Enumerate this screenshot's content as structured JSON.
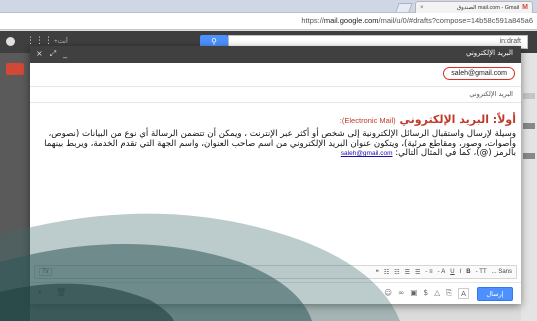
{
  "browser": {
    "tab_title": "mail.com - Gmail الصندوق",
    "tab_close": "×",
    "url_prefix": "https://",
    "url_host": "mail.google.com",
    "url_path": "/mail/u/0/#drafts?compose=14b58c591a845a6"
  },
  "gmail_bar": {
    "plus_label": "+أنت",
    "search_value": "in:draft"
  },
  "compose": {
    "window_title": "البريد الإلكتروني",
    "controls": [
      "×",
      "⤢",
      "_"
    ],
    "recipient": "saleh@gmail.com",
    "subject": "البريد الإلكتروني",
    "heading_ar": "أولاً: البريد الإلكتروني",
    "heading_en": "(Electronic Mail):",
    "body_text": "وسيلة لإرسال واستقبال الرسائل الإلكترونية إلى شخص أو أكثر عبر الإنترنت ، ويمكن أن تتضمن الرسالة أي نوع من البيانات (نصوص، وأصوات، وصور، ومقاطع مرئية)، ويتكون عنوان البريد الإلكتروني من اسم صاحب العنوان، واسم الجهة التي تقدم الخدمة، ويربط بينهما بالرمز (@)، كما في المثال التالي: ",
    "body_email": "saleh@gmail.com",
    "send_label": "إرسال",
    "format_toggle": "A"
  },
  "format_toolbar": {
    "items": [
      "Sans ...",
      "TT -",
      "A -",
      "B",
      "I",
      "U",
      "A -",
      "≡ -",
      "☰",
      "☰",
      "☷",
      "☷",
      "❝",
      "Tx"
    ]
  },
  "icons": {
    "apps": "grid-apps-icon",
    "search": "search-icon",
    "trash": "trash-icon",
    "more": "more-options-icon"
  },
  "colors": {
    "accent_blue": "#4d90fe",
    "heading_red": "#c0392b",
    "recipient_border": "#d93025",
    "gmail_bar": "#3f3f3f",
    "decor_teal": "#3f6b6b"
  }
}
